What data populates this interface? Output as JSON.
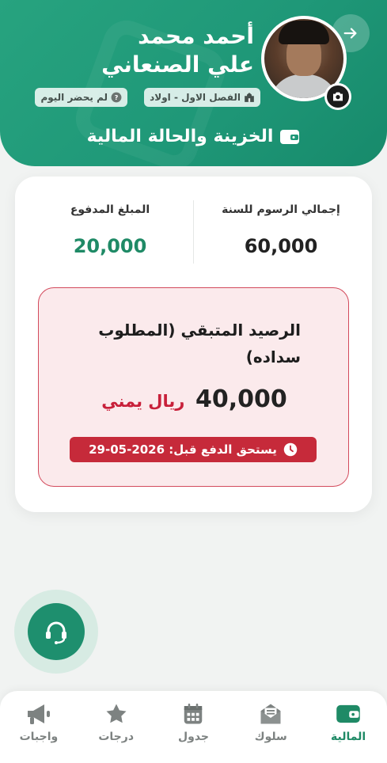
{
  "header": {
    "student_name": "أحمد محمد علي الصنعاني",
    "class_badge": "الفصل الاول - اولاد",
    "attendance_badge": "لم يحضر اليوم",
    "section_title": "الخزينة والحالة المالية",
    "icons": {
      "back": "arrow-right-icon",
      "camera": "camera-icon",
      "class": "school-icon",
      "attendance": "question-icon",
      "section": "wallet-icon"
    }
  },
  "finance": {
    "total_label": "إجمالي الرسوم للسنة",
    "total_value": "60,000",
    "paid_label": "المبلغ المدفوع",
    "paid_value": "20,000",
    "balance_title": "الرصيد المتبقي (المطلوب سداده)",
    "balance_amount": "40,000",
    "balance_currency": "ريال يمني",
    "due_text": "يستحق الدفع قبل: 2026-05-29"
  },
  "support": {
    "icon": "headset-icon"
  },
  "nav": {
    "items": [
      {
        "label": "واجبات",
        "icon": "megaphone-icon",
        "active": false
      },
      {
        "label": "درجات",
        "icon": "star-icon",
        "active": false
      },
      {
        "label": "جدول",
        "icon": "calendar-icon",
        "active": false
      },
      {
        "label": "سلوك",
        "icon": "envelope-icon",
        "active": false
      },
      {
        "label": "المالية",
        "icon": "wallet-icon",
        "active": true
      }
    ]
  },
  "colors": {
    "primary": "#1f9878",
    "paid": "#1f8a66",
    "danger": "#c62a3a",
    "danger_bg": "#fbeaec"
  }
}
